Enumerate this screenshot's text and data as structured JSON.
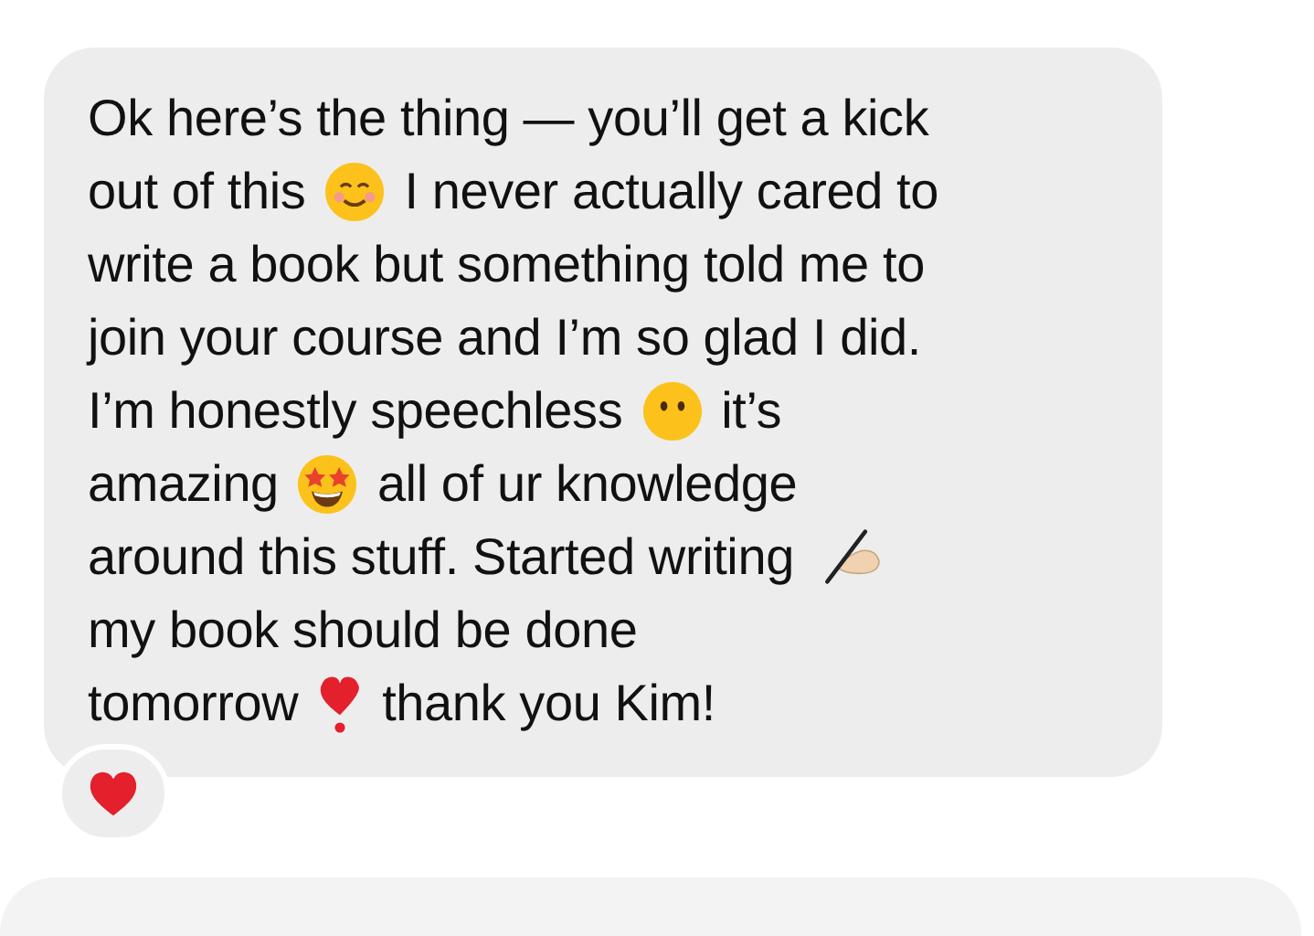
{
  "message": {
    "lines": [
      [
        {
          "kind": "text",
          "text": "Ok here’s the thing — you’ll get a kick"
        }
      ],
      [
        {
          "kind": "text",
          "text": "out of this"
        },
        {
          "kind": "smiling-emoji"
        },
        {
          "kind": "text",
          "text": "I never actually cared to"
        }
      ],
      [
        {
          "kind": "text",
          "text": "write a book but something told me to"
        }
      ],
      [
        {
          "kind": "text",
          "text": "join your course and I’m so glad I did."
        }
      ],
      [
        {
          "kind": "text",
          "text": "I’m honestly speechless"
        },
        {
          "kind": "no-mouth-emoji"
        },
        {
          "kind": "text",
          "text": "it’s"
        }
      ],
      [
        {
          "kind": "text",
          "text": "amazing"
        },
        {
          "kind": "star-eyes-emoji"
        },
        {
          "kind": "text",
          "text": "all of ur knowledge"
        }
      ],
      [
        {
          "kind": "text",
          "text": "around this stuff. Started writing"
        },
        {
          "kind": "writing-hand-emoji"
        }
      ],
      [
        {
          "kind": "text",
          "text": "my book should be done"
        }
      ],
      [
        {
          "kind": "text",
          "text": "tomorrow"
        },
        {
          "kind": "heart-exclamation-emoji"
        },
        {
          "kind": "text",
          "text": "thank you Kim!"
        }
      ]
    ],
    "reaction": {
      "kind": "heart"
    }
  }
}
